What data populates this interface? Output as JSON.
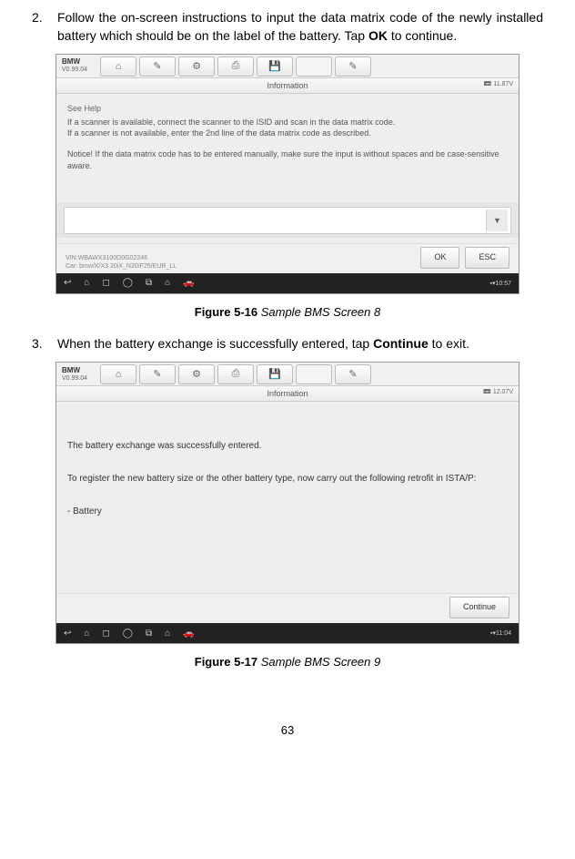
{
  "steps": {
    "step2": {
      "num": "2.",
      "text_p1": "Follow the on-screen instructions to input the data matrix code of the newly installed battery which should be on the label of the battery. Tap ",
      "text_bold": "OK",
      "text_p2": " to continue."
    },
    "step3": {
      "num": "3.",
      "text_p1": "When the battery exchange is successfully entered, tap ",
      "text_bold": "Continue",
      "text_p2": " to exit."
    }
  },
  "screenshot1": {
    "brand": "BMW",
    "version": "V0.99.04",
    "info_title": "Information",
    "voltage": "11.87V",
    "see_help": "See Help",
    "help_line1": "If a scanner is available, connect the scanner to the ISID and scan in the data matrix code.",
    "help_line2": "If a scanner is not available, enter the 2nd line of the data matrix code as described.",
    "notice": "Notice! If the data matrix code has to be entered manually, make sure the input is without spaces and be case-sensitive aware.",
    "vin": "VIN:WBAWX3100D0G02246",
    "car": "Car: bmw/X/X3 20iX_N20/F25/EUR_LL",
    "btn_ok": "OK",
    "btn_esc": "ESC",
    "time": "10:57"
  },
  "screenshot2": {
    "brand": "BMW",
    "version": "V0.99.04",
    "info_title": "Information",
    "voltage": "12.07V",
    "msg1": "The battery exchange was successfully entered.",
    "msg2": "To register the new battery size or the other battery type, now carry out the following retrofit in ISTA/P:",
    "msg3": "- Battery",
    "btn_continue": "Continue",
    "time": "11:04"
  },
  "captions": {
    "fig1_bold": "Figure 5-16",
    "fig1_ital": " Sample BMS Screen 8",
    "fig2_bold": "Figure 5-17",
    "fig2_ital": " Sample BMS Screen 9"
  },
  "page_number": "63"
}
